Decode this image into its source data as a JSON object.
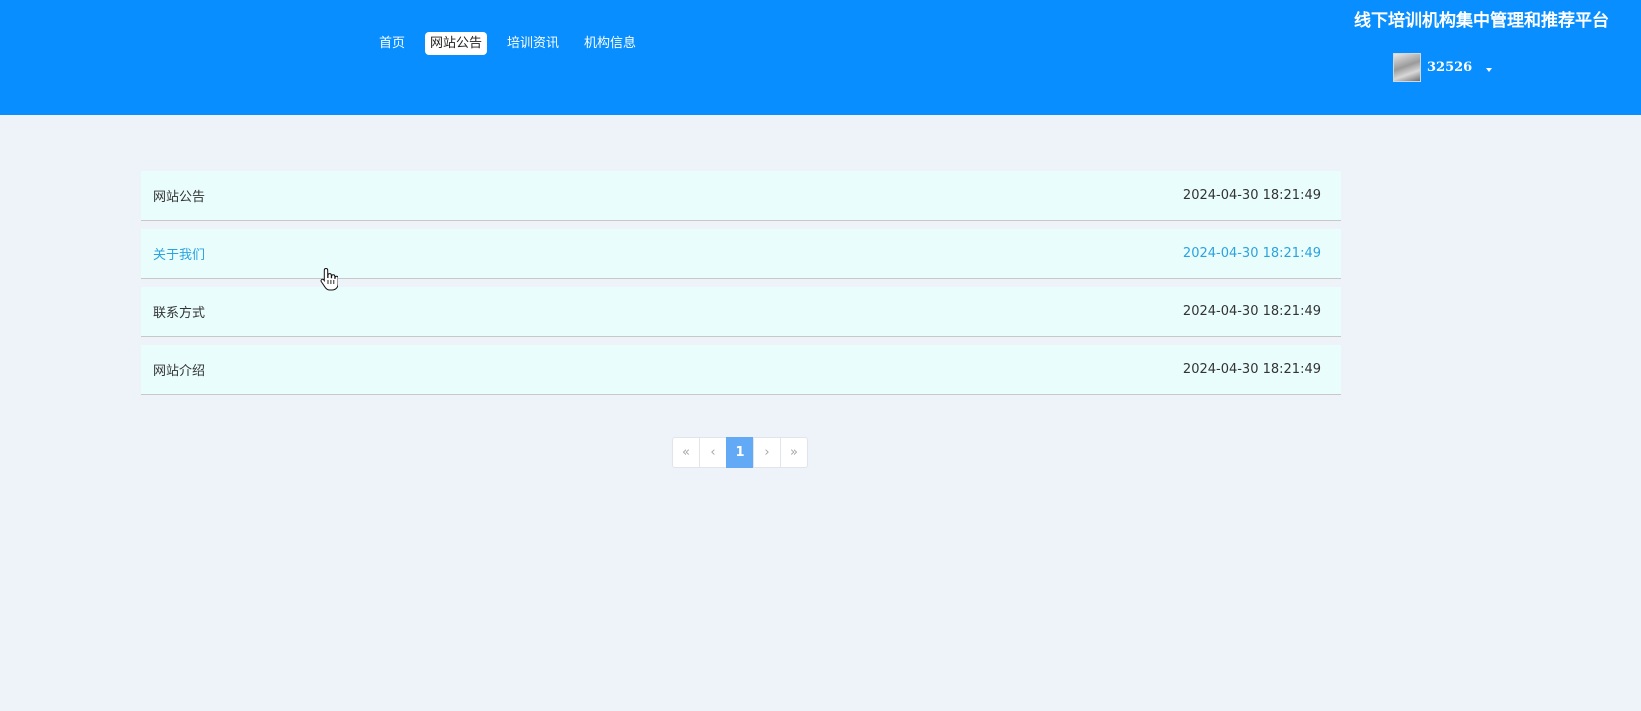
{
  "header": {
    "nav": [
      {
        "label": "首页"
      },
      {
        "label": "网站公告",
        "active": true
      },
      {
        "label": "培训资讯"
      },
      {
        "label": "机构信息"
      }
    ],
    "site_title": "线下培训机构集中管理和推荐平台",
    "user": {
      "name": "32526",
      "avatar_icon": "user-avatar"
    },
    "colors": {
      "header_bg": "#088eff",
      "page_bg": "#eef2f9",
      "row_bg": "#eafdfd",
      "hover_text": "#2aa3e0",
      "pagination_active": "#62aaf6"
    }
  },
  "main": {
    "items": [
      {
        "title": "网站公告",
        "date": "2024-04-30 18:21:49"
      },
      {
        "title": "关于我们",
        "date": "2024-04-30 18:21:49",
        "hovered": true
      },
      {
        "title": "联系方式",
        "date": "2024-04-30 18:21:49"
      },
      {
        "title": "网站介绍",
        "date": "2024-04-30 18:21:49"
      }
    ]
  },
  "pagination": {
    "first": "«",
    "prev": "‹",
    "current": "1",
    "next": "›",
    "last": "»"
  }
}
